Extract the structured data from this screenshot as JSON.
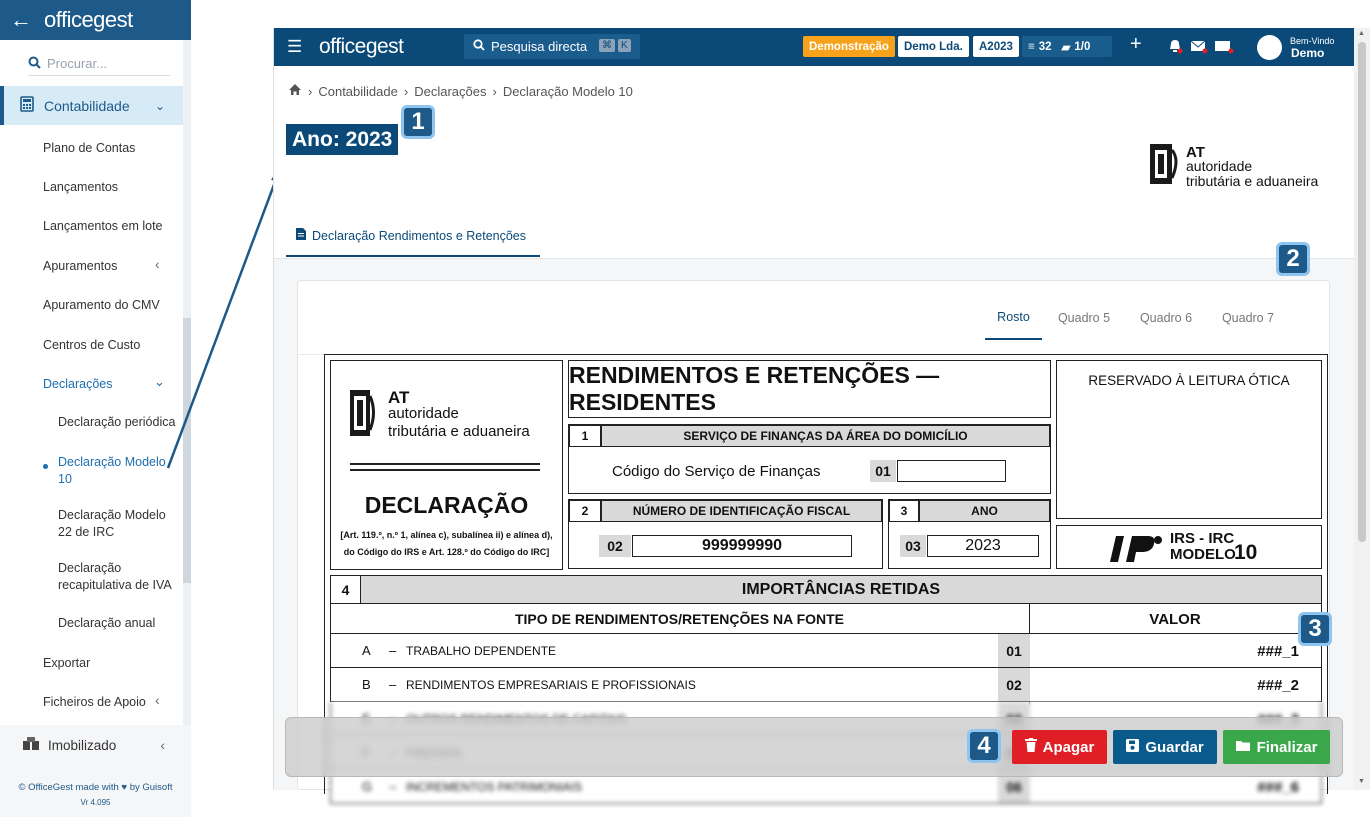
{
  "sidebar": {
    "logo": "officegest",
    "search_placeholder": "Procurar...",
    "group": "Contabilidade",
    "items": [
      {
        "label": "Plano de Contas"
      },
      {
        "label": "Lançamentos"
      },
      {
        "label": "Lançamentos em lote"
      },
      {
        "label": "Apuramentos"
      },
      {
        "label": "Apuramento do CMV"
      },
      {
        "label": "Centros de Custo"
      },
      {
        "label": "Declarações"
      },
      {
        "label": "Declaração periódica"
      },
      {
        "label": "Declaração Modelo 10"
      },
      {
        "label": "Declaração Modelo 22 de IRC"
      },
      {
        "label": "Declaração recapitulativa de IVA"
      },
      {
        "label": "Declaração anual"
      },
      {
        "label": "Exportar"
      },
      {
        "label": "Ficheiros de Apoio"
      }
    ],
    "group2": "Imobilizado",
    "footer": "© OfficeGest made with ♥ by Guisoft",
    "version": "Vr 4.095"
  },
  "topbar": {
    "logo": "officegest",
    "search": "Pesquisa directa",
    "shortcut_1": "⌘",
    "shortcut_2": "K",
    "demo_tag": "Demonstração",
    "company_tag": "Demo Lda.",
    "year_tag": "A2023",
    "count_1": "32",
    "count_2": "1/0",
    "welcome": "Bem-Vindo",
    "user": "Demo"
  },
  "breadcrumb": [
    "Contabilidade",
    "Declarações",
    "Declaração Modelo 10"
  ],
  "page_title": "Ano: 2023",
  "tab_main": "Declaração Rendimentos e Retenções",
  "at_logo": {
    "line1": "AT",
    "line2": "autoridade",
    "line3": "tributária e aduaneira"
  },
  "inner_tabs": [
    "Rosto",
    "Quadro 5",
    "Quadro 6",
    "Quadro 7"
  ],
  "badges": [
    "1",
    "2",
    "3",
    "4"
  ],
  "form": {
    "at_line1": "AT",
    "at_line2": "autoridade",
    "at_line3": "tributária e aduaneira",
    "declaracao": "DECLARAÇÃO",
    "legal_1": "[Art. 119.º, n.º 1, alínea c), subalínea ii) e alínea d),",
    "legal_2": "do Código do IRS e Art. 128.º do Código do IRC]",
    "title": "RENDIMENTOS E RETENÇÕES — RESIDENTES",
    "reserved": "RESERVADO À LEITURA ÓTICA",
    "s1_num": "1",
    "s1_title": "SERVIÇO DE FINANÇAS DA ÁREA DO DOMICÍLIO",
    "s1_label": "Código do Serviço de Finanças",
    "s1_field": "01",
    "s2_num": "2",
    "s2_title": "NÚMERO DE IDENTIFICAÇÃO FISCAL",
    "s2_field": "02",
    "nif": "999999990",
    "s3_num": "3",
    "s3_title": "ANO",
    "s3_field": "03",
    "ano": "2023",
    "irs_1": "IRS - IRC",
    "irs_2": "MODELO",
    "irs_3": "10",
    "s4_num": "4",
    "s4_title": "IMPORTÂNCIAS RETIDAS",
    "col_tipo": "TIPO DE RENDIMENTOS/RETENÇÕES NA FONTE",
    "col_valor": "VALOR",
    "rows": [
      {
        "letter": "A",
        "label": "TRABALHO DEPENDENTE",
        "code": "01",
        "value": "###_1"
      },
      {
        "letter": "B",
        "label": "RENDIMENTOS EMPRESARIAIS E PROFISSIONAIS",
        "code": "02",
        "value": "###_2"
      },
      {
        "letter": "E",
        "label": "OUTROS RENDIMENTOS DE CAPITAIS",
        "code": "03",
        "value": "###_3"
      },
      {
        "letter": "F",
        "label": "PREDIAIS",
        "code": "04",
        "value": "###_4"
      },
      {
        "letter": "G",
        "label": "INCREMENTOS PATRIMONIAIS",
        "code": "06",
        "value": "###_6"
      }
    ]
  },
  "actions": {
    "delete": "Apagar",
    "save": "Guardar",
    "finish": "Finalizar"
  },
  "colors": {
    "primary": "#0b4a78",
    "danger": "#e01e25",
    "save": "#0b5a8c",
    "success": "#3aa84a",
    "demo": "#f6a21a"
  }
}
